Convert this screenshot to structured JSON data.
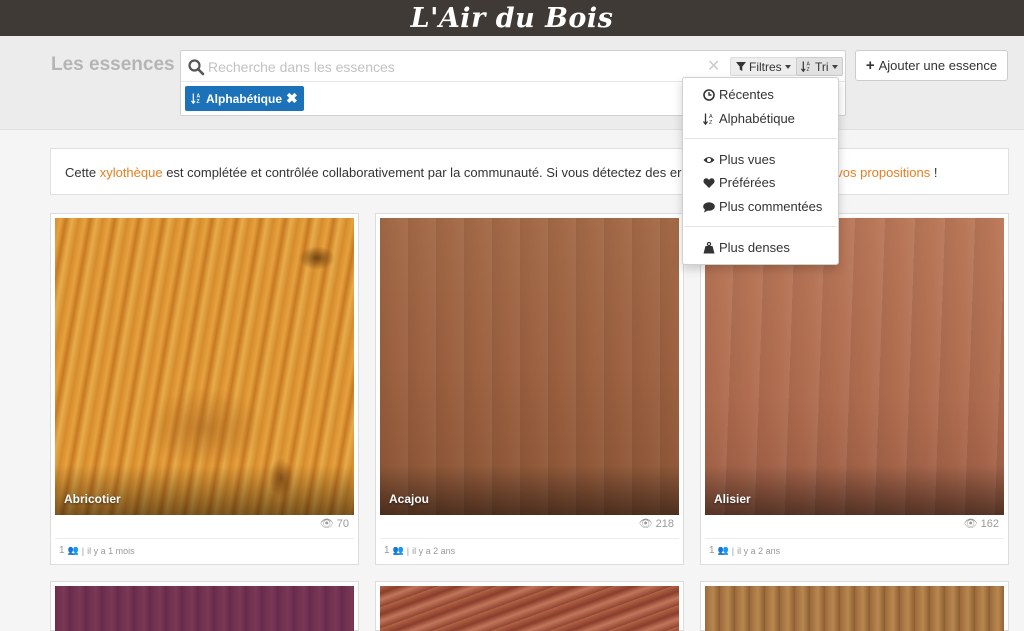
{
  "header": {
    "brand": "L'Air du Bois"
  },
  "toolbar": {
    "title": "Les essences",
    "search_placeholder": "Recherche dans les essences",
    "filters_label": "Filtres",
    "sort_label": "Tri",
    "active_sort_chip": "Alphabétique",
    "add_label": "Ajouter une essence"
  },
  "notice": {
    "before": "Cette ",
    "link1": "xylothèque",
    "middle": " est complétée et contrôlée collaborativement par la communauté. Si vous détectez des err",
    "link2": "ortez vos propositions",
    "after": " !"
  },
  "sort_menu": {
    "group1": [
      "Récentes",
      "Alphabétique"
    ],
    "group2": [
      "Plus vues",
      "Préférées",
      "Plus commentées"
    ],
    "group3": [
      "Plus denses"
    ]
  },
  "cards": [
    {
      "name": "Abricotier",
      "views": "70",
      "count": "1",
      "date": "il y a 1 mois"
    },
    {
      "name": "Acajou",
      "views": "218",
      "count": "1",
      "date": "il y a 2 ans"
    },
    {
      "name": "Alisier",
      "views": "162",
      "count": "1",
      "date": "il y a 2 ans"
    }
  ],
  "colors": {
    "topbar": "#3f3a35",
    "accent_blue": "#1b72b8",
    "link_orange": "#e67e22"
  }
}
